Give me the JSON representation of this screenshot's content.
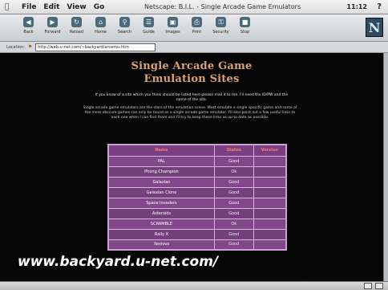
{
  "menubar": {
    "apple": "",
    "items": [
      "File",
      "Edit",
      "View",
      "Go"
    ],
    "window_title": "Netscape: B.I.L. - Single Arcade Game Emulators",
    "clock": "11:12",
    "help": "?"
  },
  "toolbar": {
    "buttons": [
      {
        "label": "Back",
        "icon": "back-arrow-icon",
        "glyph": "◀"
      },
      {
        "label": "Forward",
        "icon": "forward-arrow-icon",
        "glyph": "▶"
      },
      {
        "label": "Reload",
        "icon": "reload-icon",
        "glyph": "↻"
      },
      {
        "label": "Home",
        "icon": "home-icon",
        "glyph": "⌂"
      },
      {
        "label": "Search",
        "icon": "search-icon",
        "glyph": "⚲"
      },
      {
        "label": "Guide",
        "icon": "guide-icon",
        "glyph": "☰"
      },
      {
        "label": "Images",
        "icon": "images-icon",
        "glyph": "▣"
      },
      {
        "label": "Print",
        "icon": "print-icon",
        "glyph": "⎙"
      },
      {
        "label": "Security",
        "icon": "lock-icon",
        "glyph": "⚿"
      },
      {
        "label": "Stop",
        "icon": "stop-icon",
        "glyph": "■"
      }
    ],
    "logo": "N"
  },
  "location": {
    "label": "Location:",
    "url": "http://web.u-net.com/~backyard/arcemu.htm"
  },
  "page": {
    "title_line1": "Single Arcade Game",
    "title_line2": "Emulation Sites",
    "intro": "If you know of a site which you think should be listed here please mail it to me. I'll need the ID/PW and the name of the site.",
    "body": "Single arcade game emulators are the stars of the emulation scene. Most emulate a single specific game and some of the more obscure games can only be found as a single arcade game emulator. I'll also point out a few useful links to each one when I can find them and I'll try to keep these links as up to date as possible."
  },
  "table": {
    "headers": [
      "Name",
      "Status",
      "Version"
    ],
    "rows": [
      [
        "PAL",
        "Good",
        ""
      ],
      [
        "Phong Champion",
        "Ok",
        ""
      ],
      [
        "Galaxian",
        "Good",
        ""
      ],
      [
        "Galaxian Clone",
        "Good",
        ""
      ],
      [
        "Space Invaders",
        "Good",
        ""
      ],
      [
        "Asteroids",
        "Good",
        ""
      ],
      [
        "SCRAMBLE",
        "Ok",
        ""
      ],
      [
        "Rally X",
        "Good",
        ""
      ],
      [
        "Xevious",
        "Good",
        ""
      ]
    ]
  },
  "watermark": "www.backyard.u-net.com/",
  "statusbar": {
    "text": ""
  },
  "colors": {
    "page_bg": "#060606",
    "title": "#d9a36f",
    "table_bg": "#6d3a72",
    "table_header_text": "#ff7a6a"
  }
}
